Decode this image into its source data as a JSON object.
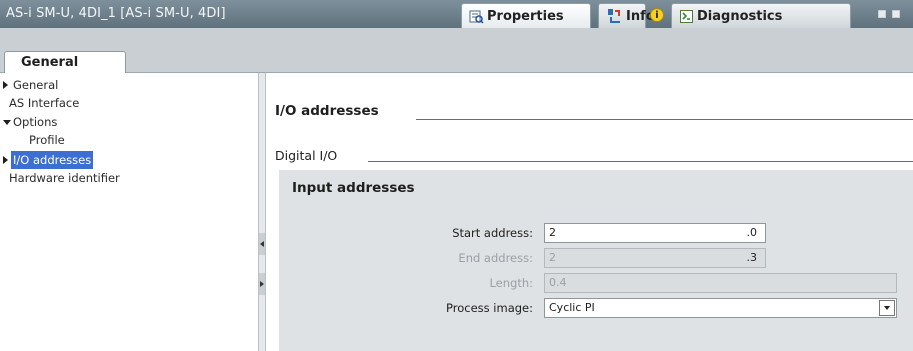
{
  "window": {
    "title": "AS-i SM-U, 4DI_1 [AS-i SM-U, 4DI]"
  },
  "inspector_tabs": [
    {
      "label": "Properties",
      "icon": "properties-icon",
      "active": true
    },
    {
      "label": "Info",
      "icon": "info-icon",
      "active": false
    },
    {
      "label": "Diagnostics",
      "icon": "diagnostics-icon",
      "active": false
    }
  ],
  "info_badge": "i",
  "section_tabs": [
    {
      "label": "General",
      "active": true
    }
  ],
  "nav": {
    "items": [
      {
        "label": "General",
        "expander": "collapsed"
      },
      {
        "label": "AS Interface",
        "expander": "none"
      },
      {
        "label": "Options",
        "expander": "expanded"
      },
      {
        "label": "Profile",
        "expander": "none",
        "level": 2
      },
      {
        "label": "I/O addresses",
        "expander": "collapsed",
        "selected": true
      },
      {
        "label": "Hardware identifier",
        "expander": "none"
      }
    ]
  },
  "main": {
    "section_title": "I/O addresses",
    "subsection_title": "Digital I/O",
    "group_title": "Input addresses",
    "fields": {
      "start_address": {
        "label": "Start address:",
        "value": "2",
        "suffix": ".0",
        "enabled": true
      },
      "end_address": {
        "label": "End address:",
        "value": "2",
        "suffix": ".3",
        "enabled": false
      },
      "length": {
        "label": "Length:",
        "value": "0.4",
        "enabled": false
      },
      "process_image": {
        "label": "Process image:",
        "value": "Cyclic PI",
        "enabled": true
      }
    }
  },
  "colors": {
    "titlebar": "#6b7d88",
    "selection": "#3c6fd1",
    "group_bg": "#dfe2e4"
  }
}
